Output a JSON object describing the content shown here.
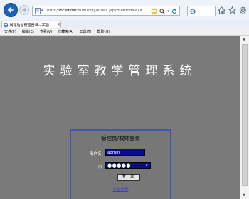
{
  "browser": {
    "url_prefix": "http://",
    "url_host": "localhost",
    "url_rest": ":8080/syy/index.jsp?method=exit",
    "compat_icon": "compat-view-icon",
    "search_icon": "search-icon",
    "refresh_icon": "refresh-icon",
    "home_icon": "home-icon",
    "favorites_icon": "star-icon",
    "settings_icon": "gear-icon",
    "accent_color": "#1c62b9"
  },
  "tab": {
    "title": "网站后台管理登录---实验...",
    "close": "×"
  },
  "menu": {
    "file": "文件(F)",
    "edit": "编辑(E)",
    "view": "查看(V)",
    "favorites": "收藏夹(A)",
    "tools": "工具(T)",
    "help": "帮助(H)"
  },
  "page": {
    "title": "实验室教学管理系统",
    "background_color": "#7a7a7a"
  },
  "login": {
    "panel_title": "管理员/教师登录",
    "username_label": "用户名",
    "username_value": "admin",
    "password_label": "口 令",
    "password_mask": "●●●●●",
    "submit_label": "登 录",
    "student_link": "学生登录",
    "border_color": "#3f55b5",
    "input_color": "#0a0a8c"
  }
}
